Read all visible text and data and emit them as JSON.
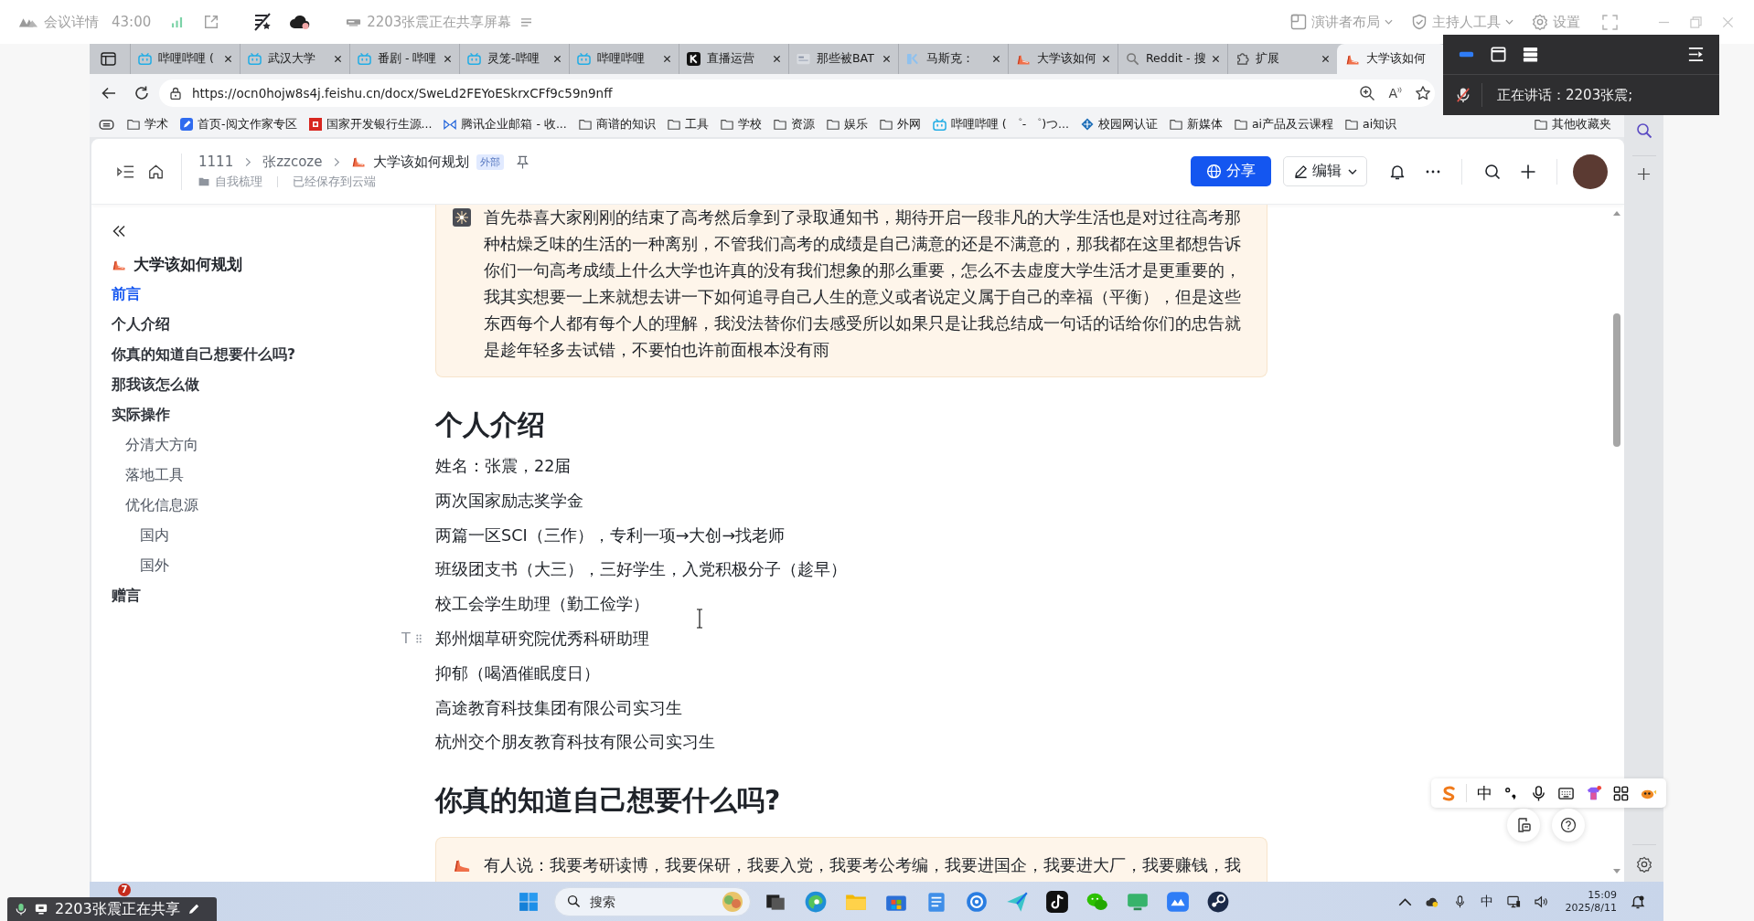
{
  "meeting_bar": {
    "title": "会议详情",
    "timer": "43:00",
    "sharing_status": "2203张震正在共享屏幕",
    "controls": [
      {
        "kind": "layout",
        "label": "演讲者布局"
      },
      {
        "kind": "host",
        "label": "主持人工具"
      },
      {
        "kind": "settings",
        "label": "设置"
      }
    ]
  },
  "speaker_panel": {
    "speaking": "正在讲话：2203张震;"
  },
  "browser": {
    "tabs": [
      {
        "kind": "video",
        "title": "哔哩哔哩 (",
        "selected": false
      },
      {
        "kind": "video",
        "title": "武汉大学",
        "selected": false
      },
      {
        "kind": "video",
        "title": "番剧 - 哔哩",
        "selected": false
      },
      {
        "kind": "video",
        "title": "灵笼-哔哩",
        "selected": false
      },
      {
        "kind": "video",
        "title": "哔哩哔哩",
        "selected": false
      },
      {
        "kind": "live",
        "title": "直播运营",
        "selected": false
      },
      {
        "kind": "page",
        "title": "那些被BAT",
        "selected": false
      },
      {
        "kind": "article",
        "title": "马斯克：",
        "selected": false
      },
      {
        "kind": "doc",
        "title": "大学该如何",
        "selected": false
      },
      {
        "kind": "search",
        "title": "Reddit - 搜",
        "selected": false
      },
      {
        "kind": "extension",
        "title": "扩展",
        "selected": false
      },
      {
        "kind": "doc",
        "title": "大学该如何",
        "selected": true
      }
    ],
    "url": "https://ocn0hojw8s4j.feishu.cn/docx/SweLd2FEYoESkrxCFf9c59n9nff",
    "reader_glyph": "A",
    "bookmarks": [
      {
        "kind": "folder",
        "label": "学术"
      },
      {
        "kind": "pen",
        "label": "首页-阅文作家专区"
      },
      {
        "kind": "bank",
        "label": "国家开发银行生源..."
      },
      {
        "kind": "mail",
        "label": "腾讯企业邮箱 - 收..."
      },
      {
        "kind": "folder",
        "label": "商谱的知识"
      },
      {
        "kind": "folder",
        "label": "工具"
      },
      {
        "kind": "folder",
        "label": "学校"
      },
      {
        "kind": "folder",
        "label": "资源"
      },
      {
        "kind": "folder",
        "label": "娱乐"
      },
      {
        "kind": "folder",
        "label": "外网"
      },
      {
        "kind": "video",
        "label": "哔哩哔哩 ( ゜- ゜)つ..."
      },
      {
        "kind": "network",
        "label": "校园网认证"
      },
      {
        "kind": "folder",
        "label": "新媒体"
      },
      {
        "kind": "folder",
        "label": "ai产品及云课程"
      },
      {
        "kind": "folder",
        "label": "ai知识"
      }
    ],
    "other_bookmarks": {
      "label": "其他收藏夹"
    }
  },
  "doc": {
    "breadcrumbs": [
      {
        "label": "1111"
      },
      {
        "label": "张zzcoze"
      }
    ],
    "title": "大学该如何规划",
    "badge": "外部",
    "folder": "自我梳理",
    "save_status": "已经保存到云端",
    "share_label": "分享",
    "edit_label": "编辑",
    "outline": {
      "title": "大学该如何规划",
      "items": [
        {
          "label": "前言",
          "selected": true
        },
        {
          "label": "个人介绍",
          "selected": false
        },
        {
          "label": "你真的知道自己想要什么吗?",
          "selected": false
        },
        {
          "label": "那我该怎么做",
          "selected": false
        },
        {
          "label": "实际操作",
          "selected": false,
          "children": [
            {
              "label": "分清大方向",
              "selected": false
            },
            {
              "label": "落地工具",
              "selected": false
            },
            {
              "label": "优化信息源",
              "selected": false,
              "children": [
                {
                  "label": "国内",
                  "selected": false
                },
                {
                  "label": "国外",
                  "selected": false
                }
              ]
            }
          ]
        },
        {
          "label": "赠言",
          "selected": false
        }
      ]
    },
    "handle_glyph": "T",
    "blocks": [
      {
        "kind": "callout",
        "hovered": false,
        "text": "首先恭喜大家刚刚的结束了高考然后拿到了录取通知书，期待开启一段非凡的大学生活也是对过往高考那种枯燥乏味的生活的一种离别，不管我们高考的成绩是自己满意的还是不满意的，那我都在这里都想告诉你们一句高考成绩上什么大学也许真的没有我们想象的那么重要，怎么不去虚度大学生活才是更重要的，我其实想要一上来就想去讲一下如何追寻自己人生的意义或者说定义属于自己的幸福（平衡），但是这些东西每个人都有每个人的理解，我没法替你们去感受所以如果只是让我总结成一句话的话给你们的忠告就是趁年轻多去试错，不要怕也许前面根本没有雨"
      },
      {
        "kind": "heading",
        "hovered": false,
        "text": "个人介绍"
      },
      {
        "kind": "paragraph",
        "hovered": false,
        "text": "姓名：张震，22届"
      },
      {
        "kind": "paragraph",
        "hovered": false,
        "text": "两次国家励志奖学金"
      },
      {
        "kind": "paragraph",
        "hovered": false,
        "text": "两篇一区SCI（三作），专利一项→大创→找老师"
      },
      {
        "kind": "paragraph",
        "hovered": false,
        "text": "班级团支书（大三），三好学生，入党积极分子（趁早）"
      },
      {
        "kind": "paragraph",
        "hovered": false,
        "text": "校工会学生助理（勤工俭学）"
      },
      {
        "kind": "paragraph",
        "hovered": true,
        "text": "郑州烟草研究院优秀科研助理"
      },
      {
        "kind": "paragraph",
        "hovered": false,
        "text": "抑郁（喝酒催眠度日）"
      },
      {
        "kind": "paragraph",
        "hovered": false,
        "text": "高途教育科技集团有限公司实习生"
      },
      {
        "kind": "paragraph",
        "hovered": false,
        "text": "杭州交个朋友教育科技有限公司实习生"
      },
      {
        "kind": "heading",
        "hovered": false,
        "text": "你真的知道自己想要什么吗?"
      },
      {
        "kind": "callout",
        "hovered": false,
        "text": "有人说：我要考研读博，我要保研，我要入党，我要考公考编，我要进国企，我要进大厂，我要赚钱，我"
      }
    ]
  },
  "ime_toolbar": {
    "mode": "中"
  },
  "taskbar": {
    "widget_badge": "7",
    "search_placeholder": "搜索",
    "ime": "中",
    "time": "15:09",
    "date": "2025/8/11"
  },
  "share_indicator": {
    "text": "2203张震正在共享"
  }
}
